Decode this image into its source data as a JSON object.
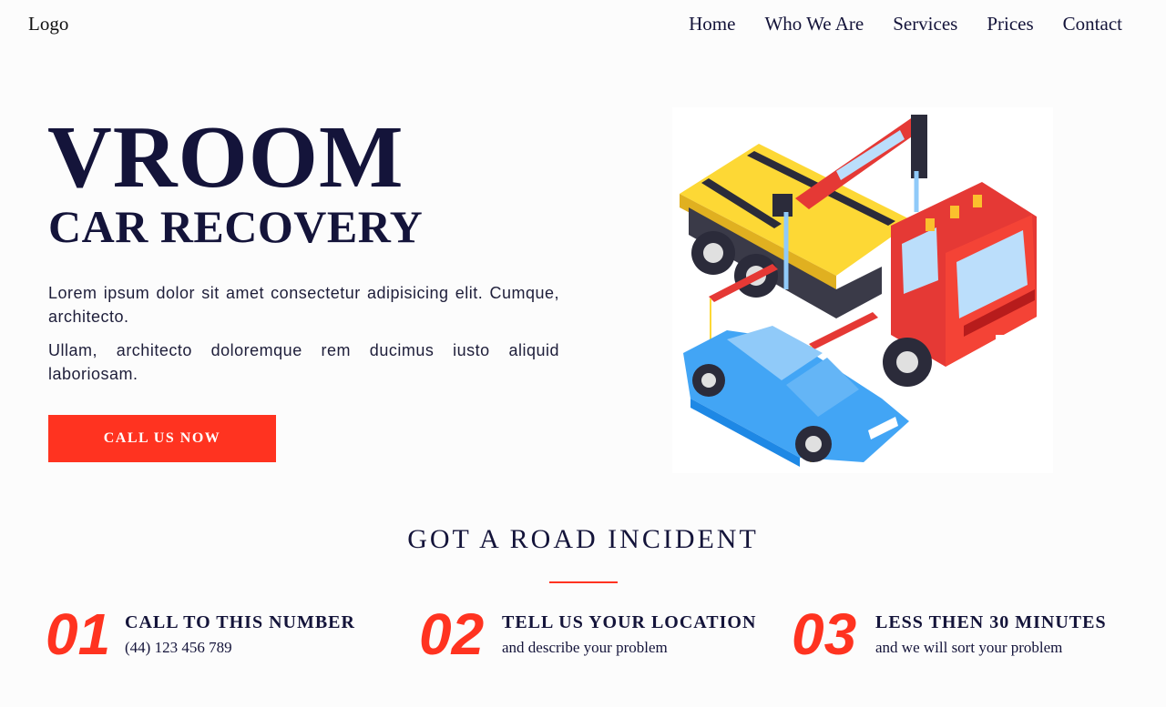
{
  "header": {
    "logo": "Logo",
    "nav": [
      "Home",
      "Who We Are",
      "Services",
      "Prices",
      "Contact"
    ]
  },
  "hero": {
    "title": "VROOM",
    "subtitle": "CAR RECOVERY",
    "paragraph1": "Lorem ipsum dolor sit amet consectetur adipisicing elit. Cumque, architecto.",
    "paragraph2": "Ullam, architecto doloremque rem ducimus iusto aliquid laboriosam.",
    "cta_label": "CALL US NOW",
    "illustration_icon": "tow-truck-with-car-icon"
  },
  "incident": {
    "title": "GOT A ROAD INCIDENT",
    "steps": [
      {
        "number": "01",
        "heading": "CALL TO THIS NUMBER",
        "detail": "(44) 123 456 789"
      },
      {
        "number": "02",
        "heading": "TELL US YOUR LOCATION",
        "detail": "and describe your problem"
      },
      {
        "number": "03",
        "heading": "LESS THEN 30 MINUTES",
        "detail": "and we will sort your problem"
      }
    ]
  },
  "colors": {
    "accent": "#ff3320",
    "text": "#14143a",
    "background": "#fcfcfc"
  }
}
